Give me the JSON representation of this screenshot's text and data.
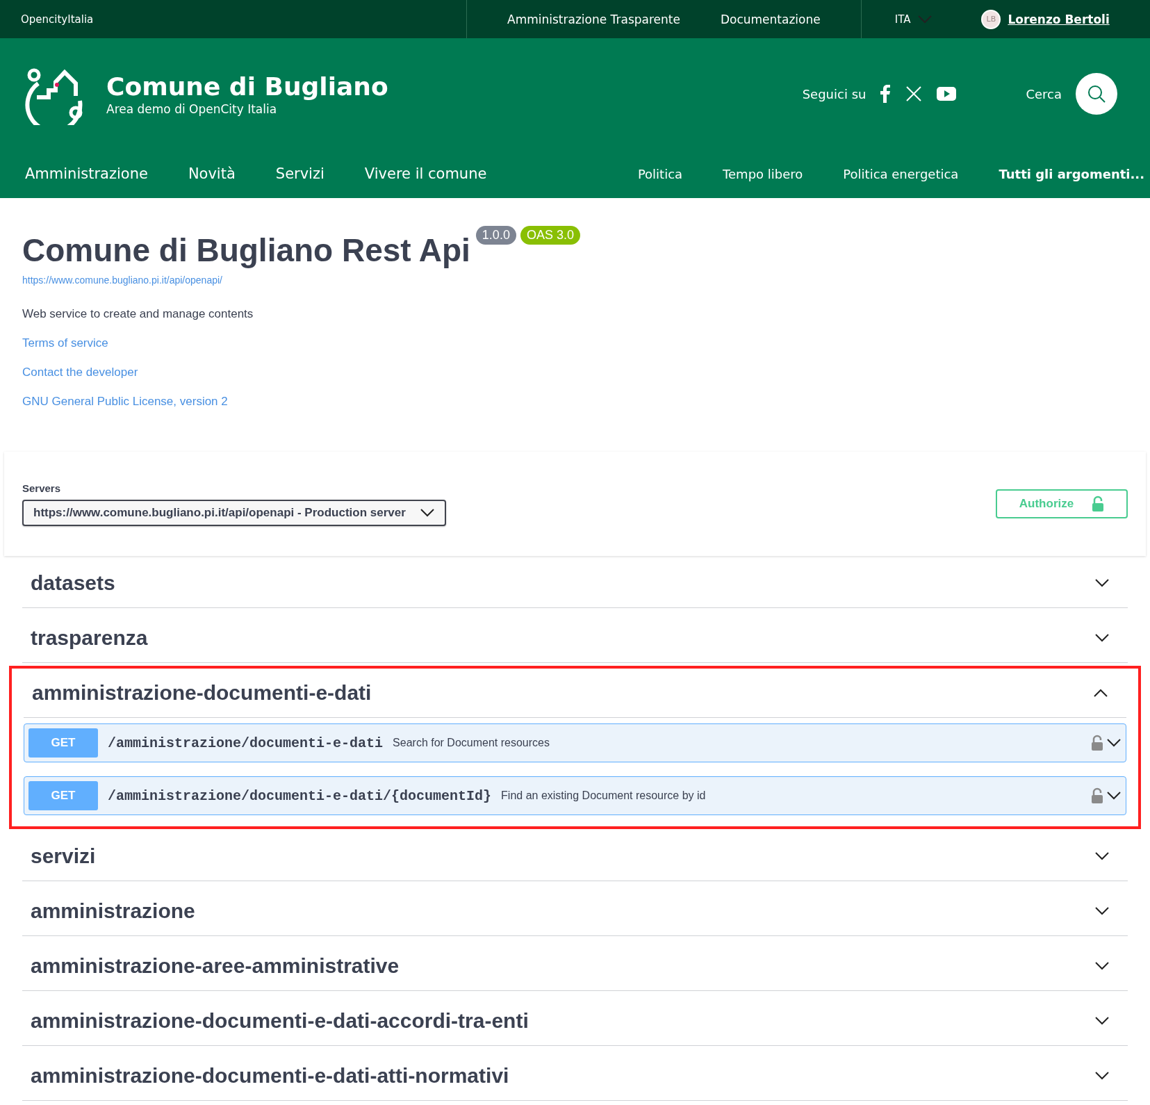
{
  "top_bar": {
    "brand": "OpencityItalia",
    "links": [
      "Amministrazione Trasparente",
      "Documentazione"
    ],
    "language": "ITA",
    "user": {
      "initials": "LB",
      "name": "Lorenzo Bertoli"
    }
  },
  "header": {
    "title": "Comune di Bugliano",
    "subtitle": "Area demo di OpenCity Italia",
    "follow_label": "Seguici su",
    "search_label": "Cerca"
  },
  "nav": {
    "main": [
      "Amministrazione",
      "Novità",
      "Servizi",
      "Vivere il comune"
    ],
    "topics": [
      "Politica",
      "Tempo libero",
      "Politica energetica"
    ],
    "all_topics": "Tutti gli argomenti..."
  },
  "info": {
    "title": "Comune di Bugliano Rest Api",
    "version": "1.0.0",
    "oas": "OAS 3.0",
    "url": "https://www.comune.bugliano.pi.it/api/openapi/",
    "description": "Web service to create and manage contents",
    "links": [
      "Terms of service",
      "Contact the developer",
      "GNU General Public License, version 2"
    ]
  },
  "servers": {
    "label": "Servers",
    "selected": "https://www.comune.bugliano.pi.it/api/openapi - Production server",
    "authorize": "Authorize"
  },
  "tags": [
    {
      "name": "datasets",
      "expanded": false
    },
    {
      "name": "trasparenza",
      "expanded": false
    },
    {
      "name": "amministrazione-documenti-e-dati",
      "expanded": true,
      "highlighted": true,
      "operations": [
        {
          "method": "GET",
          "path": "/amministrazione/documenti-e-dati",
          "summary": "Search for Document resources"
        },
        {
          "method": "GET",
          "path": "/amministrazione/documenti-e-dati/{documentId}",
          "summary": "Find an existing Document resource by id"
        }
      ]
    },
    {
      "name": "servizi",
      "expanded": false
    },
    {
      "name": "amministrazione",
      "expanded": false
    },
    {
      "name": "amministrazione-aree-amministrative",
      "expanded": false
    },
    {
      "name": "amministrazione-documenti-e-dati-accordi-tra-enti",
      "expanded": false
    },
    {
      "name": "amministrazione-documenti-e-dati-atti-normativi",
      "expanded": false
    }
  ]
}
